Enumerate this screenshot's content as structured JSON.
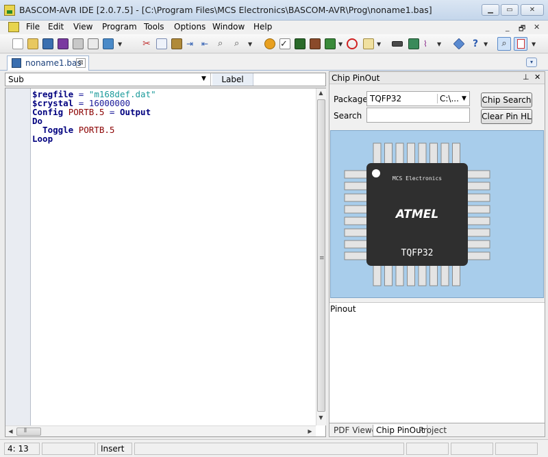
{
  "window": {
    "title": "BASCOM-AVR IDE [2.0.7.5] - [C:\\Program Files\\MCS Electronics\\BASCOM-AVR\\Prog\\noname1.bas]",
    "controls": {
      "minimize": "▁",
      "maximize": "▭",
      "close": "✕"
    }
  },
  "menubar": {
    "items": [
      "File",
      "Edit",
      "View",
      "Program",
      "Tools",
      "Options",
      "Window",
      "Help"
    ],
    "mdi": {
      "minimize": "_",
      "restore": "🗗",
      "close": "✕"
    }
  },
  "toolbar": {
    "icons": [
      "new-file",
      "open-file",
      "save",
      "save-as",
      "print",
      "print-preview",
      "export",
      "cut",
      "copy",
      "paste",
      "indent",
      "unindent",
      "find",
      "find-next",
      "compile",
      "syntax-check",
      "program-chip",
      "simulate",
      "hardware",
      "stop",
      "options",
      "lcd-designer",
      "terminal",
      "logic",
      "help-index",
      "help",
      "chip-pinout",
      "pdf"
    ],
    "colors": {
      "cut": "#c03030",
      "paste": "#b08a3a",
      "compile": "#e8a020",
      "chip": "#2a6a2a",
      "stop": "#d02020",
      "help": "#2a5ab0",
      "pdf": "#d03030",
      "blue": "#3a6fb0"
    }
  },
  "doc_tabs": {
    "active": "noname1.bas",
    "close_glyph": "⊠",
    "dropdown_glyph": "▾"
  },
  "subbar": {
    "sub_value": "Sub",
    "label_button": "Label"
  },
  "editor": {
    "lines": [
      [
        {
          "t": "$regfile",
          "c": "kw"
        },
        {
          "t": " = ",
          "c": "sym"
        },
        {
          "t": "\"m168def.dat\"",
          "c": "str"
        }
      ],
      [
        {
          "t": "$crystal",
          "c": "kw"
        },
        {
          "t": " = 16000000",
          "c": "sym"
        }
      ],
      [
        {
          "t": "Config ",
          "c": "kw"
        },
        {
          "t": "PORTB.5",
          "c": "cst"
        },
        {
          "t": " = ",
          "c": "sym"
        },
        {
          "t": "Output",
          "c": "kw"
        }
      ],
      [
        {
          "t": "Do",
          "c": "kw"
        }
      ],
      [
        {
          "t": "  Toggle ",
          "c": "kw"
        },
        {
          "t": "PORTB.5",
          "c": "cst"
        }
      ],
      [
        {
          "t": "Loop",
          "c": "kw"
        }
      ]
    ]
  },
  "chip_panel": {
    "title": "Chip PinOut",
    "pin_glyph": "⊥",
    "close_glyph": "✕",
    "package_label": "Package",
    "package_value": "TQFP32",
    "package_path": "C:\\...",
    "search_label": "Search",
    "search_value": "",
    "chip_search_button": "Chip Search",
    "clear_pin_button": "Clear Pin HL",
    "chip": {
      "maker_text": "MCS Electronics",
      "logo_text": "ATMEL",
      "package_text": "TQFP32",
      "body_color": "#2f2f2f",
      "pin_color": "#e4e4e4",
      "pins_per_side": 8
    },
    "pinout_label": "Pinout",
    "tabs": [
      "PDF Viewer",
      "Chip PinOut",
      "Project"
    ],
    "active_tab": "Chip PinOut"
  },
  "statusbar": {
    "position": "4: 13",
    "mode": "Insert"
  }
}
